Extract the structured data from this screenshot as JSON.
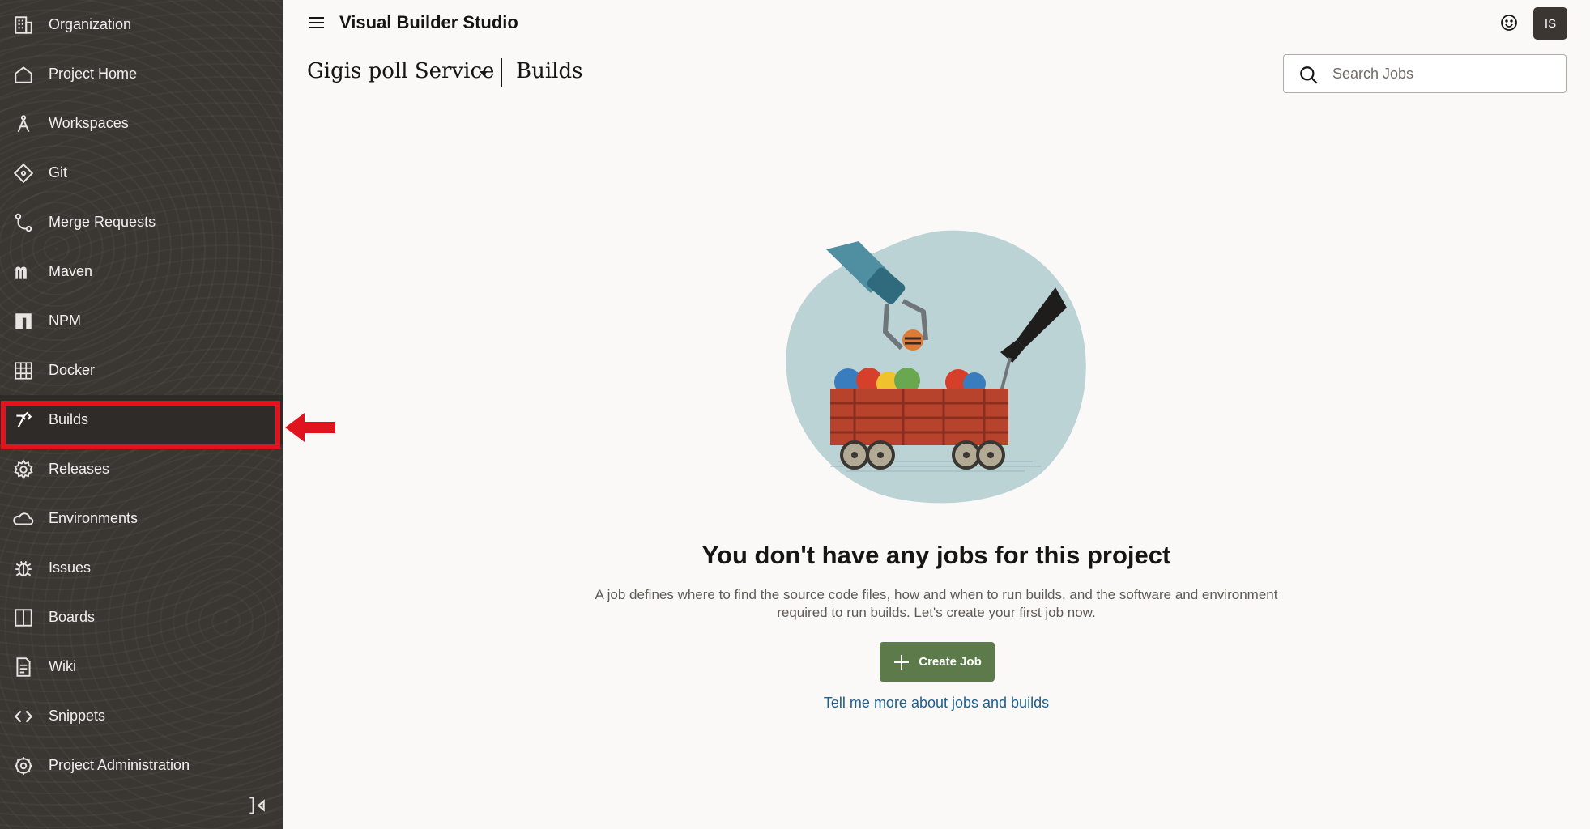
{
  "app": {
    "title": "Visual Builder Studio"
  },
  "user": {
    "initials": "IS"
  },
  "breadcrumb": {
    "project": "Gigis poll Service",
    "page": "Builds"
  },
  "search": {
    "placeholder": "Search Jobs",
    "value": ""
  },
  "sidebar": {
    "selected": "Builds",
    "items": [
      {
        "label": "Organization",
        "icon": "building-icon"
      },
      {
        "label": "Project Home",
        "icon": "home-icon"
      },
      {
        "label": "Workspaces",
        "icon": "compass-icon"
      },
      {
        "label": "Git",
        "icon": "git-icon"
      },
      {
        "label": "Merge Requests",
        "icon": "merge-icon"
      },
      {
        "label": "Maven",
        "icon": "maven-icon"
      },
      {
        "label": "NPM",
        "icon": "npm-icon"
      },
      {
        "label": "Docker",
        "icon": "docker-icon"
      },
      {
        "label": "Builds",
        "icon": "hammer-icon"
      },
      {
        "label": "Releases",
        "icon": "gear-badge-icon"
      },
      {
        "label": "Environments",
        "icon": "cloud-icon"
      },
      {
        "label": "Issues",
        "icon": "bug-icon"
      },
      {
        "label": "Boards",
        "icon": "board-icon"
      },
      {
        "label": "Wiki",
        "icon": "document-icon"
      },
      {
        "label": "Snippets",
        "icon": "code-icon"
      },
      {
        "label": "Project Administration",
        "icon": "settings-icon"
      }
    ]
  },
  "empty_state": {
    "heading": "You don't have any jobs for this project",
    "description_line1": "A job defines where to find the source code files, how and when to run builds, and the software and environment",
    "description_line2": "required to run builds. Let's create your first job now.",
    "button_label": "Create Job",
    "link_text": "Tell me more about jobs and builds"
  },
  "colors": {
    "sidebar_bg": "#3a3632",
    "highlight_red": "#e0141e",
    "primary_button": "#5d7b4a",
    "link": "#1e5e8a"
  }
}
